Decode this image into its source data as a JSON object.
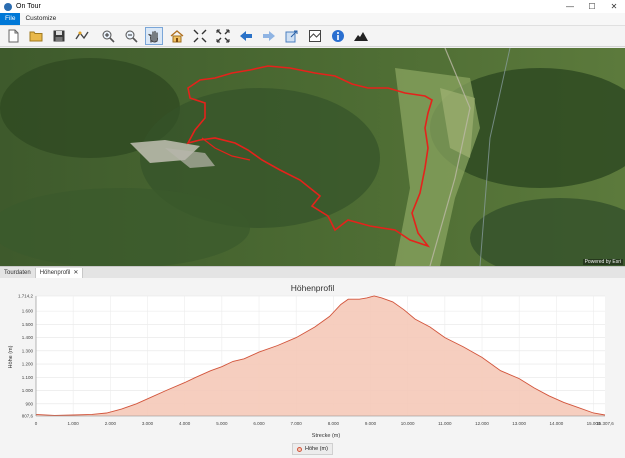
{
  "window": {
    "title": "On Tour",
    "minimize": "—",
    "maximize": "☐",
    "close": "✕"
  },
  "menu": {
    "items": [
      "File",
      "Customize"
    ]
  },
  "toolbar": {
    "buttons": [
      "new-file",
      "open-folder",
      "save-disk",
      "route-edit",
      "zoom-in",
      "zoom-out",
      "pan-hand",
      "home",
      "fit-shrink",
      "fit-expand",
      "back-arrow",
      "forward-arrow",
      "export",
      "window-frame",
      "info",
      "elevation-profile"
    ],
    "pressed": "pan-hand"
  },
  "map": {
    "credit": "Powered by Esri"
  },
  "tabs": [
    {
      "label": "Tourdaten",
      "active": false
    },
    {
      "label": "Höhenprofil",
      "active": true,
      "close": "✕"
    }
  ],
  "chart_data": {
    "type": "area",
    "title": "Höhenprofil",
    "xlabel": "Strecke (m)",
    "ylabel": "Höhe (m)",
    "xlim": [
      0,
      15308.6
    ],
    "ylim": [
      807.6,
      1714.2
    ],
    "x_ticks": [
      "0",
      "1.000",
      "2.000",
      "3.000",
      "4.000",
      "5.000",
      "6.000",
      "7.000",
      "8.000",
      "9.000",
      "10.000",
      "11.000",
      "12.000",
      "13.000",
      "14.000",
      "15.000",
      "15.307,6"
    ],
    "y_ticks": [
      "807,6",
      "900",
      "1.000",
      "1.100",
      "1.200",
      "1.300",
      "1.400",
      "1.500",
      "1.600",
      "1.714,2"
    ],
    "series": [
      {
        "name": "Höhe (m)",
        "color": "#d2553c",
        "fill": "#f5c9b8",
        "x": [
          0,
          500,
          1000,
          1500,
          1900,
          2300,
          2700,
          3100,
          3500,
          4000,
          4300,
          4700,
          5000,
          5300,
          5600,
          6000,
          6500,
          7000,
          7500,
          7900,
          8200,
          8400,
          8700,
          8900,
          9100,
          9300,
          9600,
          9900,
          10200,
          10600,
          11000,
          11500,
          12000,
          12500,
          13000,
          13400,
          13800,
          14200,
          14600,
          15000,
          15307.6
        ],
        "values": [
          820,
          812,
          815,
          820,
          830,
          860,
          900,
          950,
          1000,
          1060,
          1100,
          1150,
          1180,
          1220,
          1240,
          1290,
          1340,
          1400,
          1480,
          1560,
          1650,
          1690,
          1690,
          1700,
          1714,
          1700,
          1670,
          1610,
          1540,
          1480,
          1400,
          1330,
          1250,
          1150,
          1090,
          1020,
          960,
          910,
          870,
          830,
          815
        ]
      }
    ],
    "legend": "bottom-center"
  }
}
